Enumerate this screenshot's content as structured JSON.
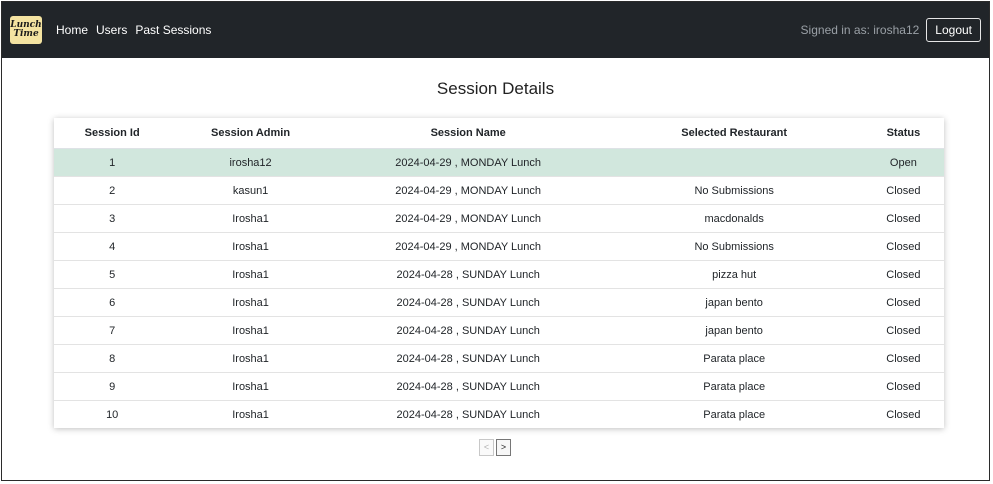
{
  "navbar": {
    "logo_line1": "Lunch",
    "logo_line2": "Time",
    "links": [
      "Home",
      "Users",
      "Past Sessions"
    ],
    "signed_in_text": "Signed in as: irosha12",
    "logout_label": "Logout"
  },
  "page": {
    "title": "Session Details"
  },
  "table": {
    "headers": [
      "Session Id",
      "Session Admin",
      "Session Name",
      "Selected Restaurant",
      "Status"
    ],
    "rows": [
      [
        "1",
        "irosha12",
        "2024-04-29 , MONDAY Lunch",
        "",
        "Open"
      ],
      [
        "2",
        "kasun1",
        "2024-04-29 , MONDAY Lunch",
        "No Submissions",
        "Closed"
      ],
      [
        "3",
        "Irosha1",
        "2024-04-29 , MONDAY Lunch",
        "macdonalds",
        "Closed"
      ],
      [
        "4",
        "Irosha1",
        "2024-04-29 , MONDAY Lunch",
        "No Submissions",
        "Closed"
      ],
      [
        "5",
        "Irosha1",
        "2024-04-28 , SUNDAY Lunch",
        "pizza hut",
        "Closed"
      ],
      [
        "6",
        "Irosha1",
        "2024-04-28 , SUNDAY Lunch",
        "japan bento",
        "Closed"
      ],
      [
        "7",
        "Irosha1",
        "2024-04-28 , SUNDAY Lunch",
        "japan bento",
        "Closed"
      ],
      [
        "8",
        "Irosha1",
        "2024-04-28 , SUNDAY Lunch",
        "Parata place",
        "Closed"
      ],
      [
        "9",
        "Irosha1",
        "2024-04-28 , SUNDAY Lunch",
        "Parata place",
        "Closed"
      ],
      [
        "10",
        "Irosha1",
        "2024-04-28 , SUNDAY Lunch",
        "Parata place",
        "Closed"
      ]
    ]
  },
  "pagination": {
    "prev_label": "<",
    "next_label": ">"
  },
  "colors": {
    "navbar_bg": "#212529",
    "highlight_row": "#d1e7dd"
  }
}
